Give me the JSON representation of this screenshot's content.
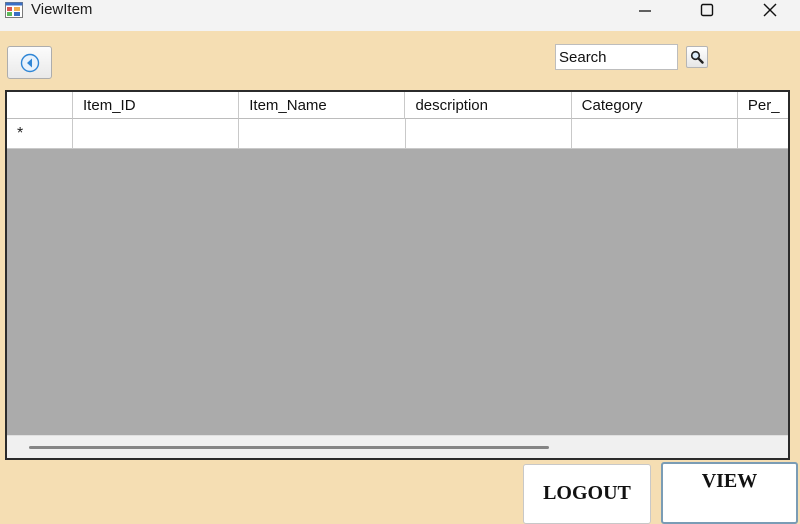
{
  "window": {
    "title": "ViewItem",
    "controls": {
      "minimize_icon": "minimize-icon",
      "maximize_icon": "maximize-icon",
      "close_icon": "close-icon"
    }
  },
  "toolbar": {
    "back_icon": "back-arrow-icon",
    "search_value": "Search",
    "search_icon": "magnifier-icon"
  },
  "grid": {
    "columns": [
      "",
      "Item_ID",
      "Item_Name",
      "description",
      "Category",
      "Per_"
    ],
    "new_row_marker": "*",
    "rows": [
      [
        "*",
        "",
        "",
        "",
        "",
        ""
      ]
    ]
  },
  "buttons": {
    "logout": "LOGOUT",
    "view": "VIEW"
  },
  "colors": {
    "form_background": "#f5deb3",
    "grid_background": "#ababab",
    "titlebar": "#f3f3f3",
    "back_icon_blue": "#2f86d6"
  }
}
